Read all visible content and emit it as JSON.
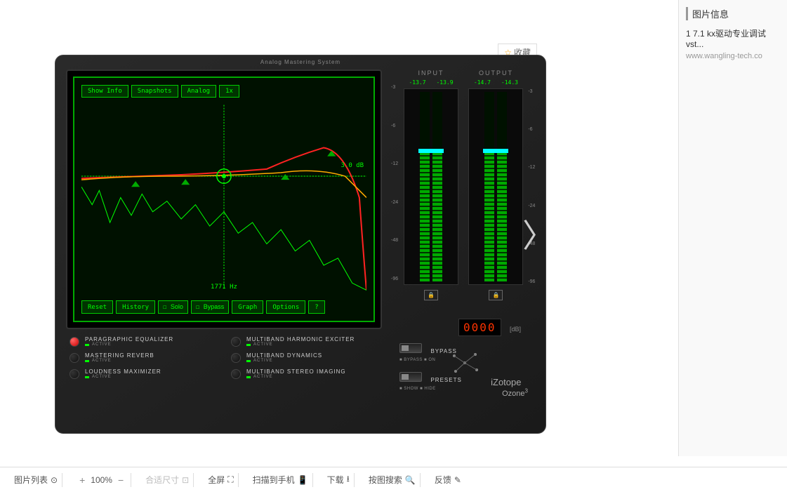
{
  "favorite": "收藏",
  "plugin": {
    "title": "Analog Mastering System",
    "topButtons": {
      "showInfo": "Show Info",
      "snapshots": "Snapshots",
      "analog": "Analog",
      "speed": "1x"
    },
    "bottomButtons": {
      "reset": "Reset",
      "history": "History",
      "solo": "Solo",
      "bypass": "Bypass",
      "graph": "Graph",
      "options": "Options",
      "help": "?"
    },
    "freq": "1771 Hz",
    "gain": "3.0 dB",
    "meters": {
      "input": {
        "label": "INPUT",
        "left": "-13.7",
        "right": "-13.9"
      },
      "output": {
        "label": "OUTPUT",
        "left": "-14.7",
        "right": "-14.3"
      },
      "scale": [
        "-3",
        "-6",
        "-12",
        "-24",
        "-48",
        "-96"
      ]
    },
    "led": "0000",
    "dbUnit": "[dB]",
    "modules": {
      "paraEq": "PARAGRAPHIC EQUALIZER",
      "harmonic": "MULTIBAND HARMONIC EXCITER",
      "reverb": "MASTERING REVERB",
      "dynamics": "MULTIBAND DYNAMICS",
      "loudness": "LOUDNESS MAXIMIZER",
      "stereo": "MULTIBAND STEREO IMAGING",
      "active": "ACTIVE"
    },
    "switches": {
      "bypass": "BYPASS",
      "bypassSub": "■ BYPASS  ■ ON",
      "presets": "PRESETS",
      "presetsSub": "■ SHOW  ■ HIDE"
    },
    "brand": "iZotope",
    "product": "Ozone",
    "version": "3"
  },
  "sidebar": {
    "title": "图片信息",
    "link": "1 7.1 kx驱动专业调试vst...",
    "url": "www.wangling-tech.co"
  },
  "bottomBar": {
    "list": "图片列表",
    "zoom": "100%",
    "fit": "合适尺寸",
    "fullscreen": "全屏",
    "scan": "扫描到手机",
    "download": "下载",
    "searchByImage": "按图搜索",
    "feedback": "反馈"
  }
}
